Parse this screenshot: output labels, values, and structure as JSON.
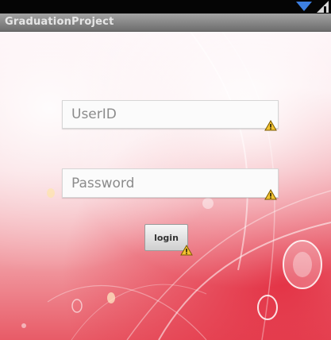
{
  "app": {
    "title": "GraduationProject"
  },
  "status_bar": {
    "icons": [
      "wifi-icon",
      "signal-icon"
    ]
  },
  "login_form": {
    "userid": {
      "placeholder": "UserID",
      "value": ""
    },
    "password": {
      "placeholder": "Password",
      "value": ""
    },
    "login_label": "login"
  },
  "colors": {
    "status_bar": "#050505",
    "title_bar": "#8a8a8a",
    "wifi_icon": "#3d7fe0",
    "warning_icon": "#f2c230"
  }
}
